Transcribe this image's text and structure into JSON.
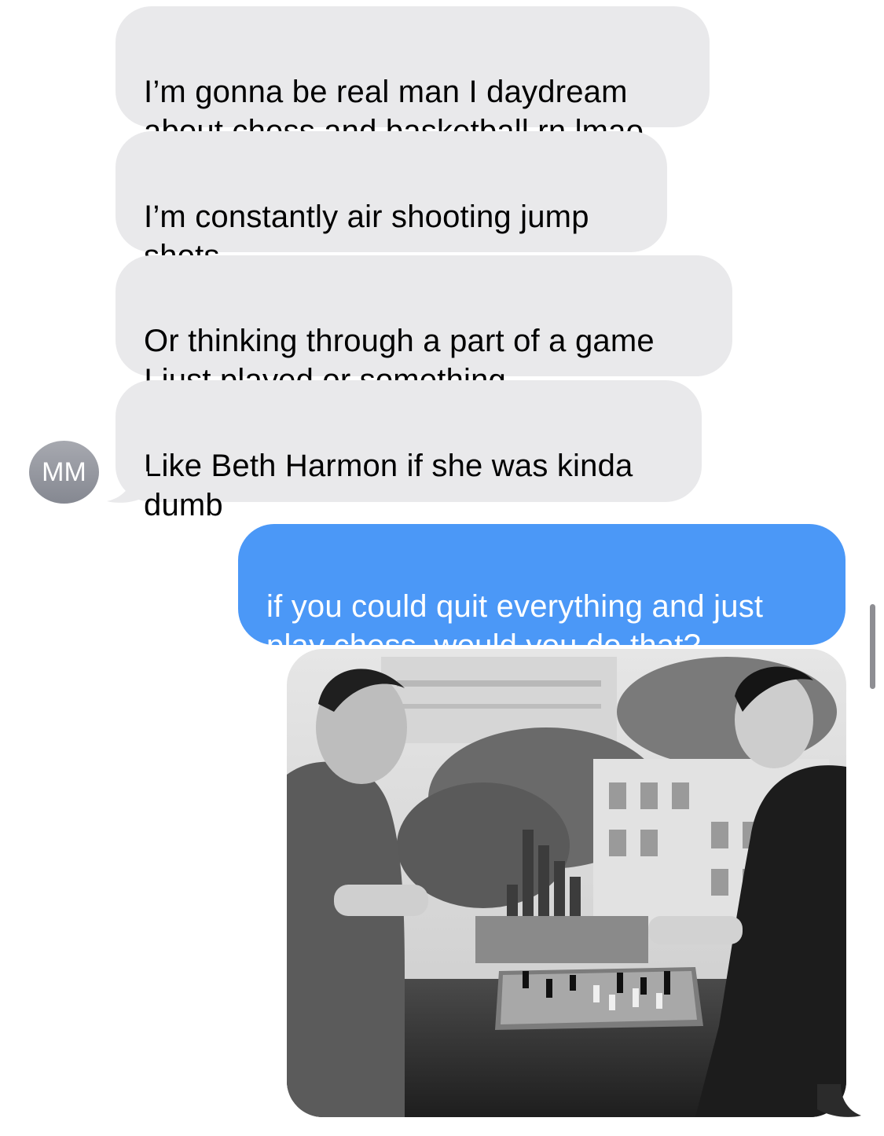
{
  "conversation": {
    "contact": {
      "initials": "MM"
    },
    "incoming_messages": [
      {
        "text": "I’m gonna be real man I daydream\nabout chess and basketball rn lmao"
      },
      {
        "text": "I’m constantly air shooting jump\nshots"
      },
      {
        "text": "Or thinking through a part of a game\nI just played or something"
      },
      {
        "text": "Like Beth Harmon if she was kinda\ndumb"
      }
    ],
    "outgoing_messages": [
      {
        "text": "if you could quit everything and just\nplay chess, would you do that?"
      }
    ],
    "attachment": {
      "type": "photo",
      "content": "black-and-white photo of two men playing chess on a rooftop"
    }
  },
  "colors": {
    "incoming_bubble": "#e9e9eb",
    "outgoing_bubble": "#4b98f7",
    "avatar": "#9a9ca3",
    "scrollbar": "#8e8e93"
  }
}
